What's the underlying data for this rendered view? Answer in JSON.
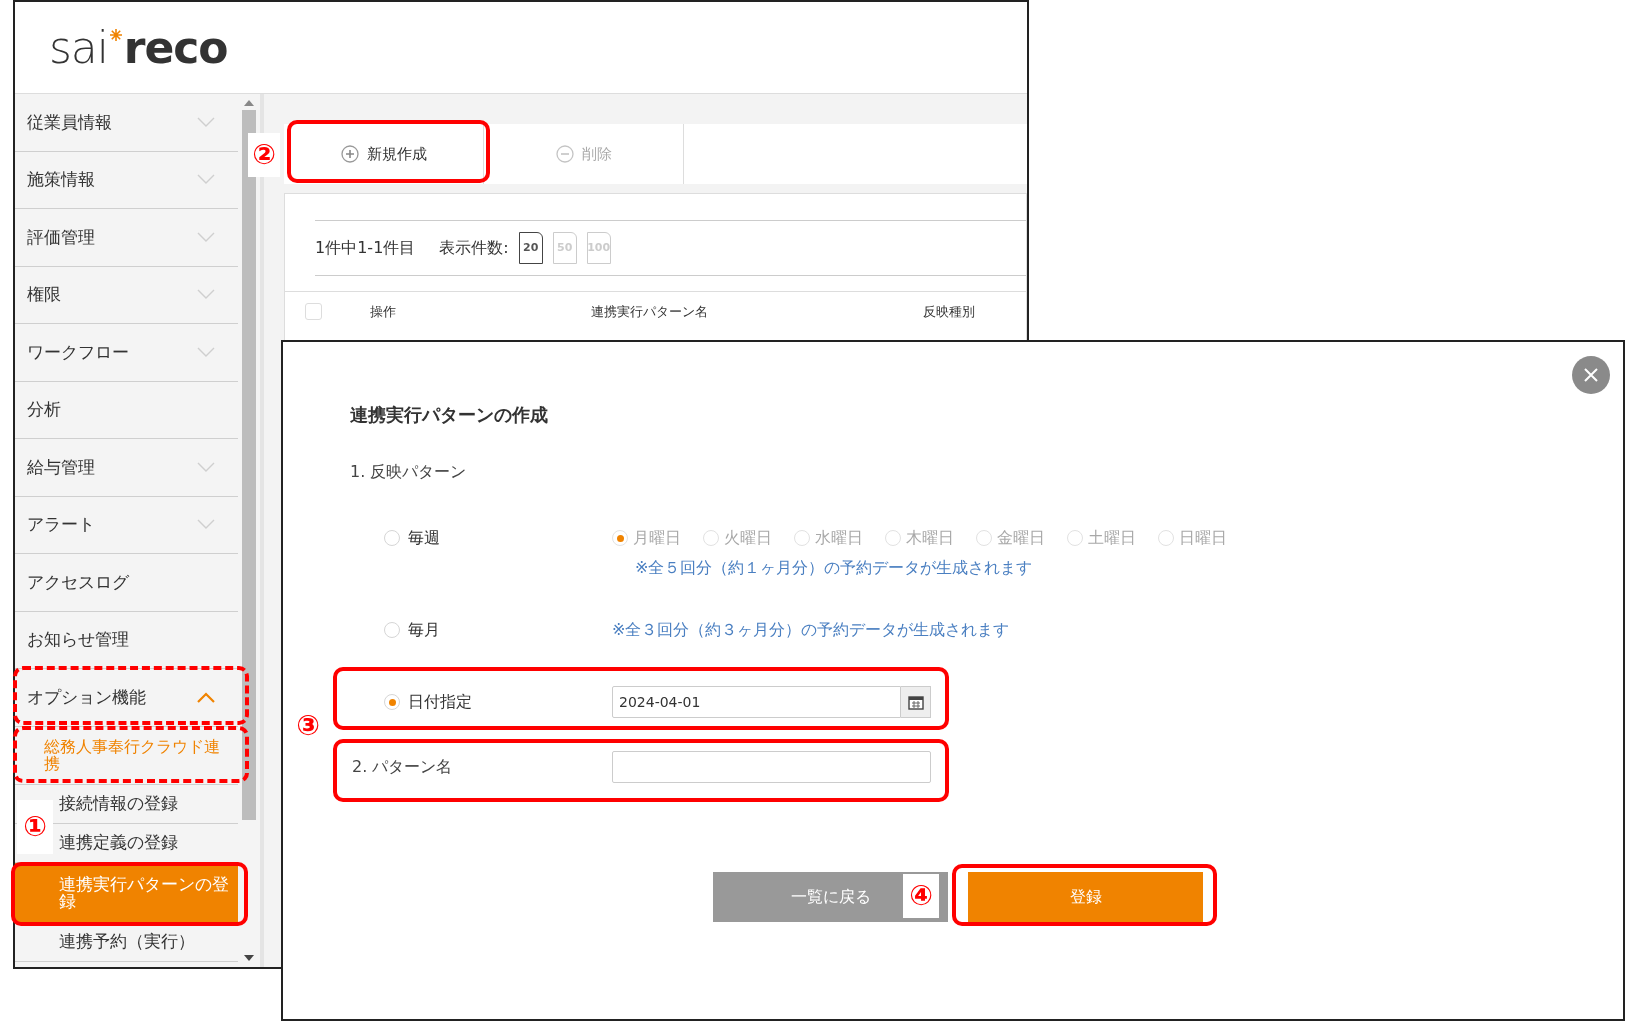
{
  "logo": {
    "light": "sai",
    "bold": "reco"
  },
  "sidebar": {
    "items": [
      {
        "label": "従業員情報",
        "kind": "menu",
        "expanded": false
      },
      {
        "label": "施策情報",
        "kind": "menu",
        "expanded": false
      },
      {
        "label": "評価管理",
        "kind": "menu",
        "expanded": false
      },
      {
        "label": "権限",
        "kind": "menu",
        "expanded": false
      },
      {
        "label": "ワークフロー",
        "kind": "menu",
        "expanded": false
      },
      {
        "label": "分析",
        "kind": "link"
      },
      {
        "label": "給与管理",
        "kind": "menu",
        "expanded": false
      },
      {
        "label": "アラート",
        "kind": "menu",
        "expanded": false
      },
      {
        "label": "アクセスログ",
        "kind": "link"
      },
      {
        "label": "お知らせ管理",
        "kind": "link"
      },
      {
        "label": "オプション機能",
        "kind": "menu",
        "expanded": true,
        "children": [
          {
            "label": "総務人事奉行クラウド連携",
            "kind": "group",
            "expanded": true,
            "children": [
              {
                "label": "接続情報の登録",
                "kind": "leaf",
                "selected": false
              },
              {
                "label": "連携定義の登録",
                "kind": "leaf",
                "selected": false
              },
              {
                "label": "連携実行パターンの登録",
                "kind": "leaf",
                "selected": true
              },
              {
                "label": "連携予約（実行）",
                "kind": "leaf",
                "selected": false
              }
            ]
          }
        ]
      }
    ]
  },
  "toolbar": {
    "buttons": [
      {
        "label": "新規作成",
        "kind": "add",
        "disabled": false
      },
      {
        "label": "削除",
        "kind": "remove",
        "disabled": true
      }
    ]
  },
  "list": {
    "count": "1件中1-1件目",
    "page_size_label": "表示件数:",
    "page_sizes": [
      {
        "label": "20",
        "selected": true
      },
      {
        "label": "50",
        "selected": false
      },
      {
        "label": "100",
        "selected": false
      }
    ],
    "select_all_checked": false,
    "columns": [
      "操作",
      "連携実行パターン名",
      "反映種別"
    ]
  },
  "dialog": {
    "title": "連携実行パターンの作成",
    "section_1": "1. 反映パターン",
    "options": [
      {
        "kind": "weekly",
        "label": "毎週",
        "selected": false,
        "weekdays_disabled": true,
        "weekdays": [
          {
            "label": "月曜日",
            "selected": true
          },
          {
            "label": "火曜日",
            "selected": false
          },
          {
            "label": "水曜日",
            "selected": false
          },
          {
            "label": "木曜日",
            "selected": false
          },
          {
            "label": "金曜日",
            "selected": false
          },
          {
            "label": "土曜日",
            "selected": false
          },
          {
            "label": "日曜日",
            "selected": false
          }
        ],
        "note": "※全５回分（約１ヶ月分）の予約データが生成されます"
      },
      {
        "kind": "monthly",
        "label": "毎月",
        "selected": false,
        "note": "※全３回分（約３ヶ月分）の予約データが生成されます"
      },
      {
        "kind": "date",
        "label": "日付指定",
        "selected": true,
        "value": "2024-04-01"
      }
    ],
    "section_2": "2. パターン名",
    "buttons": [
      {
        "label": "一覧に戻る",
        "kind": "secondary"
      },
      {
        "label": "登録",
        "kind": "primary"
      }
    ]
  },
  "annotations": {
    "numbers": [
      "②",
      "③",
      "①",
      "④"
    ]
  }
}
